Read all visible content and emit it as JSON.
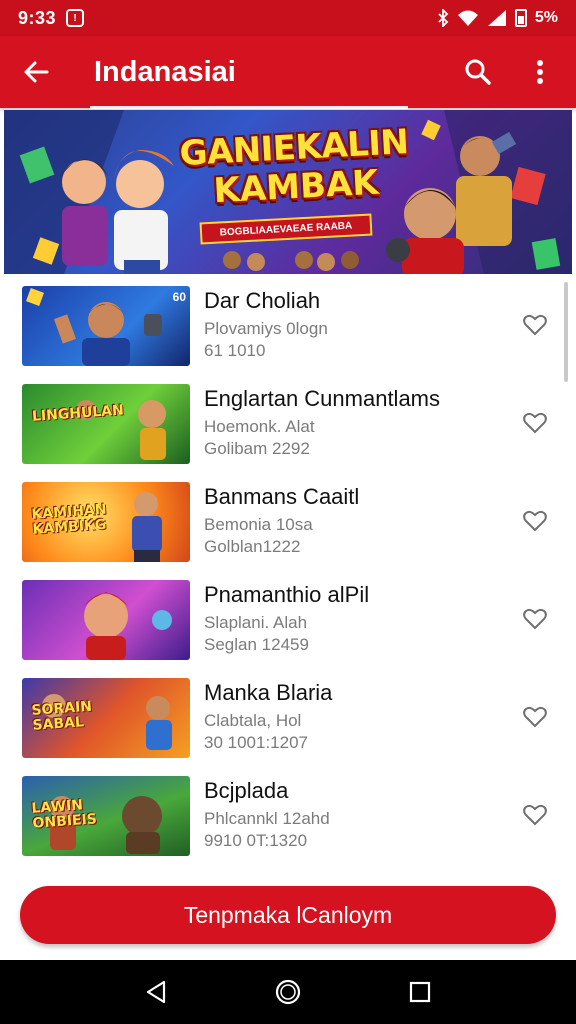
{
  "status_bar": {
    "time": "9:33",
    "battery_pct": "5%",
    "icons": [
      "notification-icon",
      "bluetooth-icon",
      "wifi-icon",
      "signal-icon",
      "battery-icon"
    ]
  },
  "app_bar": {
    "title": "Indanasiai",
    "icons": [
      "back-arrow-icon",
      "search-icon",
      "more-vertical-icon"
    ],
    "color": "#d5121f"
  },
  "banner": {
    "title_line1": "GANIEKALIN",
    "title_line2": "KAMBAK",
    "ribbon": "BOGBLIAAEVAEAE RAABA"
  },
  "items": [
    {
      "title": "Dar Choliah",
      "subtitle": "Plovamiys 0logn",
      "meta": "61 1010",
      "thumb_text": "",
      "thumb_tag": "60"
    },
    {
      "title": "Englartan Cunmantlams",
      "subtitle": "Hoemonk. Alat",
      "meta": "Golibam 2292",
      "thumb_text": "LINGHULAN",
      "thumb_tag": ""
    },
    {
      "title": "Banmans Caaitl",
      "subtitle": "Bemonia 10sa",
      "meta": "Golblan1222",
      "thumb_text": "KAMIHAN KAMBIKG",
      "thumb_tag": ""
    },
    {
      "title": "Pnamanthio alPil",
      "subtitle": "Slaplani. Alah",
      "meta": "Seglan 12459",
      "thumb_text": "",
      "thumb_tag": ""
    },
    {
      "title": "Manka Blaria",
      "subtitle": "Clabtala, Hol",
      "meta": "30 1001:1207",
      "thumb_text": "SORAIN SABAL",
      "thumb_tag": ""
    },
    {
      "title": "Bcjplada",
      "subtitle": "Phlcannkl 12ahd",
      "meta": "9910 0T:1320",
      "thumb_text": "LAWIN ONBIEIS",
      "thumb_tag": ""
    }
  ],
  "cta": {
    "label": "Tenpmaka lCanloym"
  },
  "nav": {
    "icons": [
      "back-triangle-icon",
      "home-circle-icon",
      "recents-square-icon"
    ]
  },
  "colors": {
    "brand_red": "#d5121f",
    "status_red": "#c8101d"
  }
}
